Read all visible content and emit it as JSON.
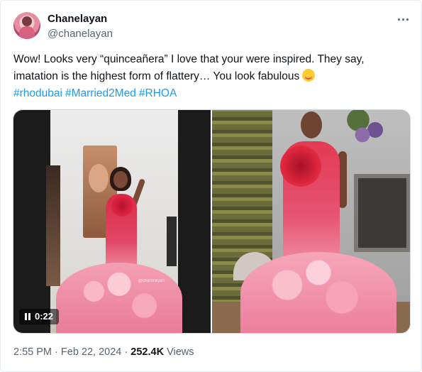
{
  "author": {
    "name": "Chanelayan",
    "handle": "@chanelayan"
  },
  "tweet": {
    "lines": [
      "Wow! Looks very “quinceañera” I love that your were inspired. They say,",
      "imatation is the highest form of flattery… You look fabulous"
    ],
    "emoji": "smiling-face-with-smiling-eyes",
    "hashtags": [
      "#rhodubai",
      "#Married2Med",
      "#RHOA"
    ]
  },
  "media": {
    "video_duration": "0:22",
    "watermark": "@chanelayan"
  },
  "meta": {
    "time": "2:55 PM",
    "separator": "·",
    "date": "Feb 22, 2024",
    "views_count": "252.4K",
    "views_label": "Views"
  },
  "colors": {
    "text": "#0f1419",
    "secondary": "#536471",
    "link": "#1d9bf0",
    "border": "#cfd9de"
  }
}
